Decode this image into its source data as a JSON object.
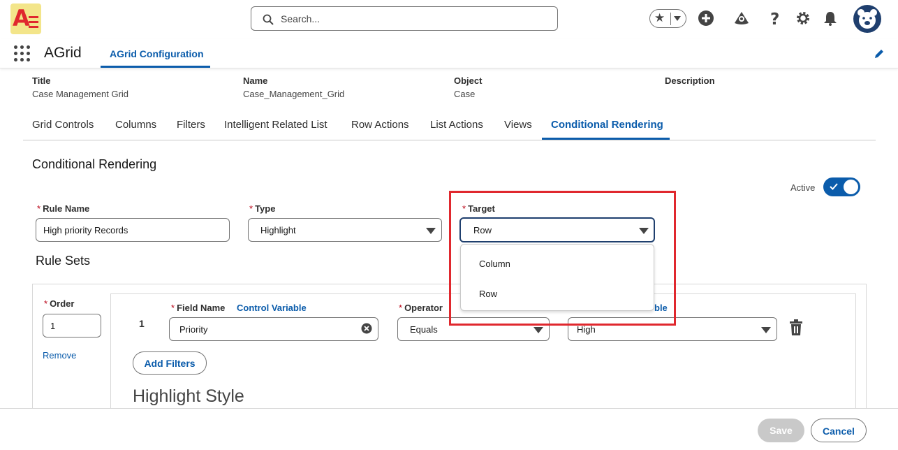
{
  "header": {
    "search_placeholder": "Search...",
    "icons": [
      "favorites-star-icon",
      "add-icon",
      "trailhead-icon",
      "help-icon",
      "setup-gear-icon",
      "notifications-bell-icon",
      "user-avatar"
    ]
  },
  "app_nav": {
    "app_name": "AGrid",
    "active_tab": "AGrid Configuration"
  },
  "record": {
    "fields": [
      {
        "label": "Title",
        "value": "Case Management Grid"
      },
      {
        "label": "Name",
        "value": "Case_Management_Grid"
      },
      {
        "label": "Object",
        "value": "Case"
      },
      {
        "label": "Description",
        "value": ""
      }
    ]
  },
  "tabs": [
    "Grid Controls",
    "Columns",
    "Filters",
    "Intelligent Related List",
    "Row Actions",
    "List Actions",
    "Views",
    "Conditional Rendering"
  ],
  "active_tab_index": 7,
  "section": {
    "title": "Conditional Rendering",
    "active_label": "Active",
    "active_on": true
  },
  "form": {
    "rule_name_label": "Rule Name",
    "rule_name_value": "High priority Records",
    "type_label": "Type",
    "type_value": "Highlight",
    "target_label": "Target",
    "target_value": "Row",
    "target_options": [
      "Column",
      "Row"
    ],
    "required_marker": "*"
  },
  "rule_sets": {
    "title": "Rule Sets",
    "order_label": "Order",
    "order_value": "1",
    "remove_label": "Remove",
    "row_number": "1",
    "field_name_label": "Field Name",
    "control_variable_label": "Control Variable",
    "field_name_value": "Priority",
    "operator_label": "Operator",
    "operator_value": "Equals",
    "value_label_suffix": "ble",
    "value_value": "High",
    "add_filters_label": "Add Filters",
    "highlight_style_title": "Highlight Style"
  },
  "footer": {
    "save_label": "Save",
    "cancel_label": "Cancel"
  },
  "colors": {
    "brand_blue": "#0b5cab",
    "highlight_red": "#e0282e",
    "required_red": "#ba0517"
  }
}
